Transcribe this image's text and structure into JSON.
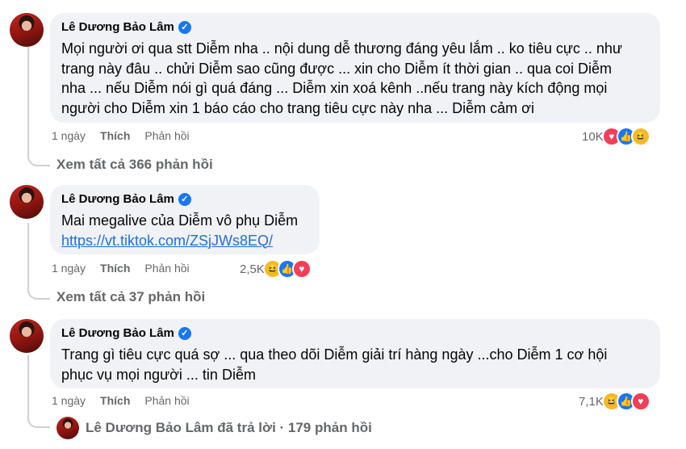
{
  "comments": [
    {
      "author": "Lê Dương Bảo Lâm",
      "lines": [
        "Mọi người ơi qua stt Diễm nha .. nội dung dễ thương đáng yêu lắm .. ko tiêu cực .. như",
        "trang này đâu .. chửi Diễm sao cũng được ... xin cho Diễm ít thời gian .. qua coi Diễm",
        "nha ... nếu Diễm nói gì quá đáng ... Diễm xin xoá kênh ..nếu trang này kích động mọi",
        "người cho Diễm xin 1 báo cáo cho trang tiêu cực này nha ... Diễm cảm ơi"
      ],
      "time": "1 ngày",
      "like_label": "Thích",
      "reply_label": "Phản hồi",
      "reaction_count": "10K",
      "reactions": [
        "heart-icon",
        "like-icon",
        "haha-icon"
      ],
      "see_all": "Xem tất cả 366 phản hồi"
    },
    {
      "author": "Lê Dương Bảo Lâm",
      "lines": [
        "Mai megalive của Diễm vô phụ Diễm"
      ],
      "link": "https://vt.tiktok.com/ZSjJWs8EQ/",
      "time": "1 ngày",
      "like_label": "Thích",
      "reply_label": "Phản hồi",
      "reaction_count": "2,5K",
      "reactions": [
        "haha-icon",
        "like-icon",
        "heart-icon"
      ],
      "see_all": "Xem tất cả 37 phản hồi"
    },
    {
      "author": "Lê Dương Bảo Lâm",
      "lines": [
        "Trang gì tiêu cực quá sợ ... qua theo dõi Diễm giải trí hàng ngày ...cho Diễm 1 cơ hội",
        "phục vụ mọi người ... tin Diễm"
      ],
      "time": "1 ngày",
      "like_label": "Thích",
      "reply_label": "Phản hồi",
      "reaction_count": "7,1K",
      "reactions": [
        "haha-icon",
        "like-icon",
        "heart-icon"
      ],
      "replied": "Lê Dương Bảo Lâm đã trả lời · 179 phản hồi"
    }
  ],
  "colors": {
    "bubble": "#f0f2f5",
    "secondary_text": "#65676b",
    "link": "#216fdb",
    "verified": "#1877f2",
    "heart": "#f33e58",
    "like": "#1877f2",
    "haha": "#f7b928"
  }
}
